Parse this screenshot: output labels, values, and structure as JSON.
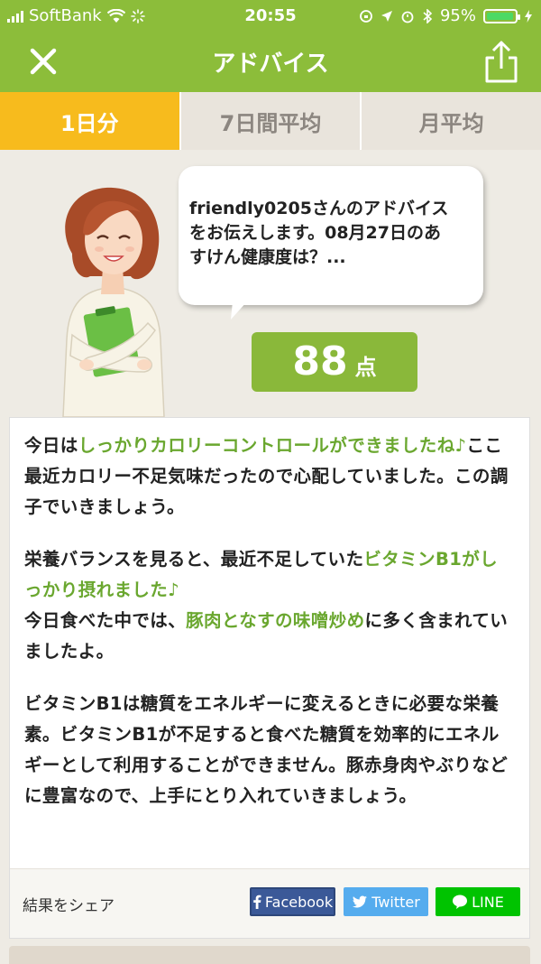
{
  "status_bar": {
    "carrier": "SoftBank",
    "time": "20:55",
    "battery": "95%",
    "battery_level": 0.95
  },
  "nav": {
    "title": "アドバイス",
    "close_icon": "close-icon",
    "share_icon": "share-icon"
  },
  "tabs": [
    {
      "label": "1日分",
      "active": true
    },
    {
      "label": "7日間平均",
      "active": false
    },
    {
      "label": "月平均",
      "active": false
    }
  ],
  "bubble": {
    "line1": "friendly0205さんのアドバイス",
    "line2": "をお伝えします。08月27日のあ",
    "line3": "すけん健康度は？..."
  },
  "score": {
    "value": "88",
    "unit": "点"
  },
  "advice": {
    "p1_a": "今日は",
    "p1_hl": "しっかりカロリーコントロールができましたね♪",
    "p1_b": "ここ最近カロリー不足気味だったので心配していました。この調子でいきましょう。",
    "p2_a": "栄養バランスを見ると、最近不足していた",
    "p2_hl": "ビタミンB1がしっかり摂れました♪",
    "p2_b": "今日食べた中では、",
    "p2_hl2": "豚肉となすの味噌炒め",
    "p2_c": "に多く含まれていましたよ。",
    "p3": "ビタミンB1は糖質をエネルギーに変えるときに必要な栄養素。ビタミンB1が不足すると食べた糖質を効率的にエネルギーとして利用することができません。豚赤身肉やぶりなどに豊富なので、上手にとり入れていきましょう。"
  },
  "share": {
    "label": "結果をシェア",
    "facebook": "Facebook",
    "twitter": "Twitter",
    "line": "LINE"
  },
  "colors": {
    "brand_green": "#8cbd3a",
    "active_tab": "#f7bb1d",
    "highlight": "#6aa72f",
    "facebook": "#3b5998",
    "twitter": "#55acee",
    "line": "#00c300"
  }
}
